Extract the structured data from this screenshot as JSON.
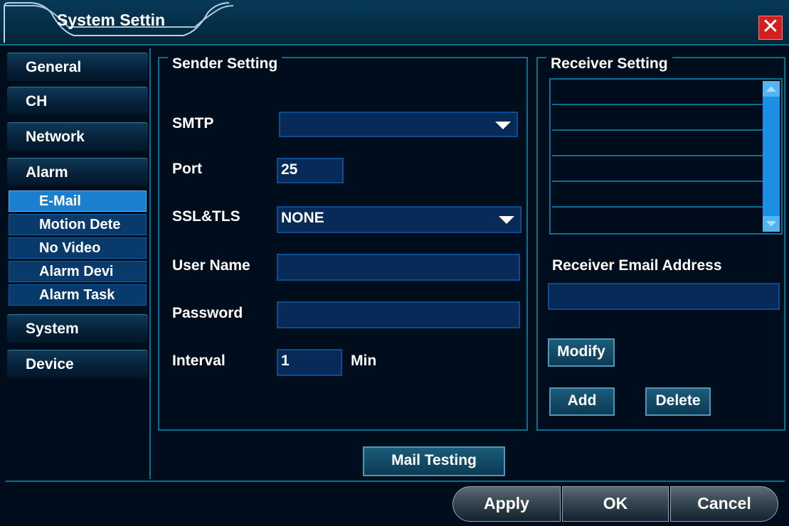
{
  "window": {
    "title": "System Settin",
    "close_glyph": "✕"
  },
  "sidebar": {
    "items": [
      {
        "label": "General"
      },
      {
        "label": "CH"
      },
      {
        "label": "Network"
      },
      {
        "label": "Alarm"
      }
    ],
    "alarm_subitems": [
      {
        "label": "E-Mail",
        "active": true
      },
      {
        "label": "Motion Dete"
      },
      {
        "label": "No Video"
      },
      {
        "label": "Alarm Devi"
      },
      {
        "label": "Alarm Task"
      }
    ],
    "bottom_items": [
      {
        "label": "System"
      },
      {
        "label": "Device"
      }
    ]
  },
  "sender": {
    "title": "Sender Setting",
    "smtp_label": "SMTP",
    "smtp_value": "",
    "port_label": "Port",
    "port_value": "25",
    "ssl_label": "SSL&TLS",
    "ssl_value": "NONE",
    "username_label": "User Name",
    "username_value": "",
    "password_label": "Password",
    "password_value": "",
    "interval_label": "Interval",
    "interval_value": "1",
    "interval_unit": "Min"
  },
  "receiver": {
    "title": "Receiver Setting",
    "rows": [
      "",
      "",
      "",
      "",
      "",
      ""
    ],
    "address_label": "Receiver Email Address",
    "address_value": "",
    "modify_label": "Modify",
    "add_label": "Add",
    "delete_label": "Delete"
  },
  "mail_testing_label": "Mail Testing",
  "footer": {
    "apply_label": "Apply",
    "ok_label": "OK",
    "cancel_label": "Cancel"
  },
  "colors": {
    "background": "#000d1c",
    "border": "#0b6f8f",
    "active_item": "#1b7fd0",
    "close": "#d02020"
  },
  "icons": [
    "close-icon",
    "dropdown-arrow-icon",
    "scroll-up-icon",
    "scroll-down-icon"
  ]
}
